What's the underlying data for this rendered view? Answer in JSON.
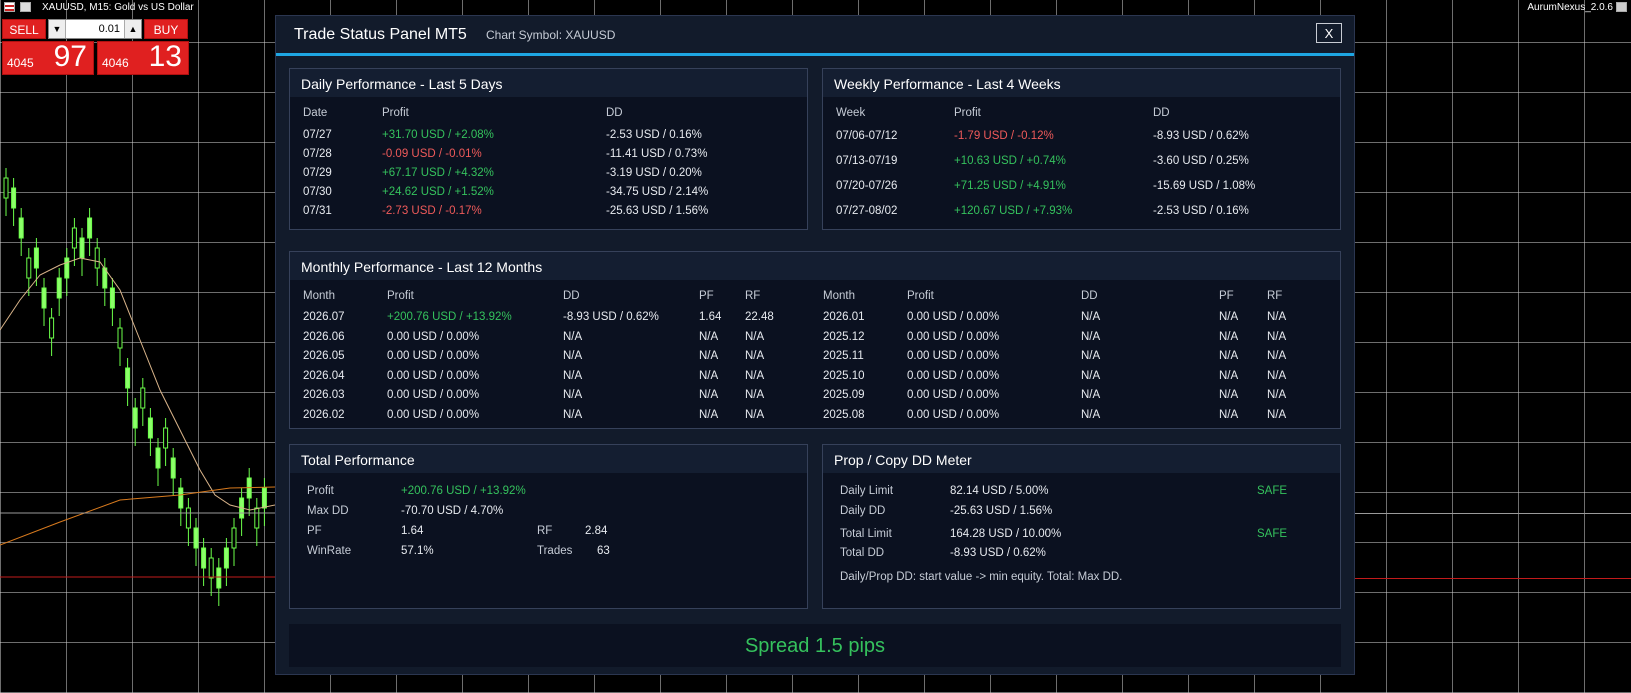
{
  "app": {
    "symbol_title": "XAUUSD, M15:  Gold vs US Dollar",
    "version": "AurumNexus_2.0.6"
  },
  "one_click": {
    "sell_label": "SELL",
    "buy_label": "BUY",
    "lot": "0.01",
    "bid_small": "4045",
    "bid_big": "97",
    "ask_small": "4046",
    "ask_big": "13"
  },
  "panel": {
    "title": "Trade Status Panel MT5",
    "chart_symbol": "Chart Symbol: XAUUSD",
    "close_label": "X"
  },
  "daily": {
    "title": "Daily Performance - Last 5 Days",
    "headers": [
      "Date",
      "Profit",
      "DD"
    ],
    "rows": [
      {
        "date": "07/27",
        "profit": "+31.70 USD / +2.08%",
        "dd": "-2.53 USD / 0.16%",
        "sign": "pos"
      },
      {
        "date": "07/28",
        "profit": "-0.09 USD / -0.01%",
        "dd": "-11.41 USD / 0.73%",
        "sign": "neg"
      },
      {
        "date": "07/29",
        "profit": "+67.17 USD / +4.32%",
        "dd": "-3.19 USD / 0.20%",
        "sign": "pos"
      },
      {
        "date": "07/30",
        "profit": "+24.62 USD / +1.52%",
        "dd": "-34.75 USD / 2.14%",
        "sign": "pos"
      },
      {
        "date": "07/31",
        "profit": "-2.73 USD / -0.17%",
        "dd": "-25.63 USD / 1.56%",
        "sign": "neg"
      }
    ]
  },
  "weekly": {
    "title": "Weekly Performance - Last 4 Weeks",
    "headers": [
      "Week",
      "Profit",
      "DD"
    ],
    "rows": [
      {
        "week": "07/06-07/12",
        "profit": "-1.79 USD / -0.12%",
        "dd": "-8.93 USD / 0.62%",
        "sign": "neg"
      },
      {
        "week": "07/13-07/19",
        "profit": "+10.63 USD / +0.74%",
        "dd": "-3.60 USD / 0.25%",
        "sign": "pos"
      },
      {
        "week": "07/20-07/26",
        "profit": "+71.25 USD / +4.91%",
        "dd": "-15.69 USD / 1.08%",
        "sign": "pos"
      },
      {
        "week": "07/27-08/02",
        "profit": "+120.67 USD / +7.93%",
        "dd": "-2.53 USD / 0.16%",
        "sign": "pos"
      }
    ]
  },
  "monthly": {
    "title": "Monthly Performance - Last 12 Months",
    "headers": [
      "Month",
      "Profit",
      "DD",
      "PF",
      "RF"
    ],
    "left_rows": [
      {
        "month": "2026.07",
        "profit": "+200.76 USD / +13.92%",
        "dd": "-8.93 USD / 0.62%",
        "pf": "1.64",
        "rf": "22.48",
        "sign": "pos"
      },
      {
        "month": "2026.06",
        "profit": "0.00 USD / 0.00%",
        "dd": "N/A",
        "pf": "N/A",
        "rf": "N/A",
        "sign": "neu"
      },
      {
        "month": "2026.05",
        "profit": "0.00 USD / 0.00%",
        "dd": "N/A",
        "pf": "N/A",
        "rf": "N/A",
        "sign": "neu"
      },
      {
        "month": "2026.04",
        "profit": "0.00 USD / 0.00%",
        "dd": "N/A",
        "pf": "N/A",
        "rf": "N/A",
        "sign": "neu"
      },
      {
        "month": "2026.03",
        "profit": "0.00 USD / 0.00%",
        "dd": "N/A",
        "pf": "N/A",
        "rf": "N/A",
        "sign": "neu"
      },
      {
        "month": "2026.02",
        "profit": "0.00 USD / 0.00%",
        "dd": "N/A",
        "pf": "N/A",
        "rf": "N/A",
        "sign": "neu"
      }
    ],
    "right_rows": [
      {
        "month": "2026.01",
        "profit": "0.00 USD / 0.00%",
        "dd": "N/A",
        "pf": "N/A",
        "rf": "N/A",
        "sign": "neu"
      },
      {
        "month": "2025.12",
        "profit": "0.00 USD / 0.00%",
        "dd": "N/A",
        "pf": "N/A",
        "rf": "N/A",
        "sign": "neu"
      },
      {
        "month": "2025.11",
        "profit": "0.00 USD / 0.00%",
        "dd": "N/A",
        "pf": "N/A",
        "rf": "N/A",
        "sign": "neu"
      },
      {
        "month": "2025.10",
        "profit": "0.00 USD / 0.00%",
        "dd": "N/A",
        "pf": "N/A",
        "rf": "N/A",
        "sign": "neu"
      },
      {
        "month": "2025.09",
        "profit": "0.00 USD / 0.00%",
        "dd": "N/A",
        "pf": "N/A",
        "rf": "N/A",
        "sign": "neu"
      },
      {
        "month": "2025.08",
        "profit": "0.00 USD / 0.00%",
        "dd": "N/A",
        "pf": "N/A",
        "rf": "N/A",
        "sign": "neu"
      }
    ]
  },
  "total": {
    "title": "Total Performance",
    "profit_label": "Profit",
    "profit_value": "+200.76 USD / +13.92%",
    "maxdd_label": "Max DD",
    "maxdd_value": "-70.70 USD / 4.70%",
    "pf_label": "PF",
    "pf_value": "1.64",
    "rf_label": "RF",
    "rf_value": "2.84",
    "winrate_label": "WinRate",
    "winrate_value": "57.1%",
    "trades_label": "Trades",
    "trades_value": "63"
  },
  "prop": {
    "title": "Prop / Copy DD Meter",
    "daily_limit_label": "Daily Limit",
    "daily_limit_value": "82.14 USD / 5.00%",
    "daily_status": "SAFE",
    "daily_dd_label": "Daily DD",
    "daily_dd_value": "-25.63 USD / 1.56%",
    "total_limit_label": "Total Limit",
    "total_limit_value": "164.28 USD / 10.00%",
    "total_status": "SAFE",
    "total_dd_label": "Total DD",
    "total_dd_value": "-8.93 USD / 0.62%",
    "note": "Daily/Prop DD: start value -> min equity. Total: Max DD."
  },
  "spread": {
    "text": "Spread  1.5 pips"
  },
  "colors": {
    "accent": "#1ea6e3",
    "positive": "#35c25d",
    "negative": "#ef5a5a",
    "panel_bg": "#121b2b",
    "box_bg": "#0b1120",
    "sell_buy_red": "#e02020"
  }
}
